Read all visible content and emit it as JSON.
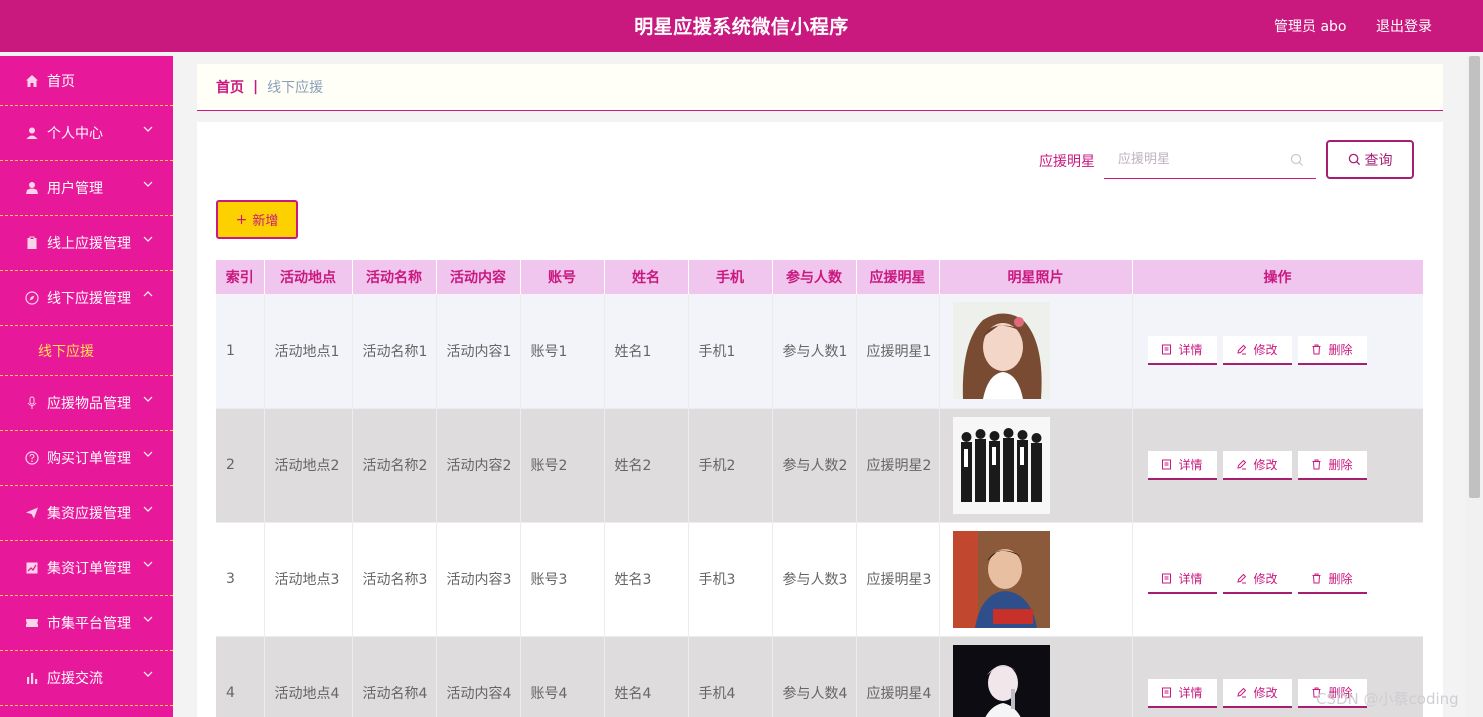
{
  "header": {
    "title": "明星应援系统微信小程序",
    "user": "管理员 abo",
    "logout": "退出登录"
  },
  "sidebar": {
    "items": [
      {
        "label": "首页",
        "icon": "home-icon"
      },
      {
        "label": "个人中心",
        "icon": "user-icon"
      },
      {
        "label": "用户管理",
        "icon": "user-manage-icon"
      },
      {
        "label": "线上应援管理",
        "icon": "clipboard-icon"
      },
      {
        "label": "线下应援管理",
        "icon": "compass-icon"
      },
      {
        "label": "应援物品管理",
        "icon": "microphone-icon"
      },
      {
        "label": "购买订单管理",
        "icon": "question-circle-icon"
      },
      {
        "label": "集资应援管理",
        "icon": "paper-plane-icon"
      },
      {
        "label": "集资订单管理",
        "icon": "chart-icon"
      },
      {
        "label": "市集平台管理",
        "icon": "ticket-icon"
      },
      {
        "label": "应援交流",
        "icon": "bar-chart-icon"
      }
    ],
    "sub_item": "线下应援"
  },
  "breadcrumb": {
    "home": "首页",
    "separator": "|",
    "current": "线下应援"
  },
  "search": {
    "label": "应援明星",
    "placeholder": "应援明星",
    "button": "查询"
  },
  "toolbar": {
    "add": "新增"
  },
  "table": {
    "headers": [
      "索引",
      "活动地点",
      "活动名称",
      "活动内容",
      "账号",
      "姓名",
      "手机",
      "参与人数",
      "应援明星",
      "明星照片",
      "操作"
    ],
    "rows": [
      [
        "1",
        "活动地点1",
        "活动名称1",
        "活动内容1",
        "账号1",
        "姓名1",
        "手机1",
        "参与人数1",
        "应援明星1"
      ],
      [
        "2",
        "活动地点2",
        "活动名称2",
        "活动内容2",
        "账号2",
        "姓名2",
        "手机2",
        "参与人数2",
        "应援明星2"
      ],
      [
        "3",
        "活动地点3",
        "活动名称3",
        "活动内容3",
        "账号3",
        "姓名3",
        "手机3",
        "参与人数3",
        "应援明星3"
      ],
      [
        "4",
        "活动地点4",
        "活动名称4",
        "活动内容4",
        "账号4",
        "姓名4",
        "手机4",
        "参与人数4",
        "应援明星4"
      ]
    ],
    "actions": {
      "detail": "详情",
      "edit": "修改",
      "delete": "删除"
    }
  },
  "watermark": "CSDN @小蔡coding",
  "colors": {
    "primary": "#c9197f",
    "sidebar": "#e8189b",
    "accent_yellow": "#fdd000",
    "header_row": "#f0c6ef"
  }
}
